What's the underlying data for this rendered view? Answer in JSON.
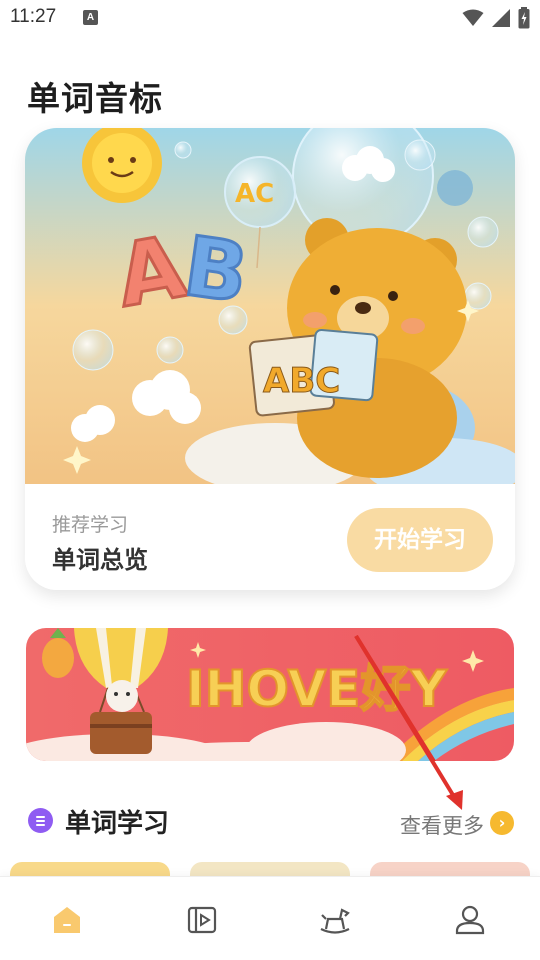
{
  "status_bar": {
    "time": "11:27",
    "notification_icon": "a-icon"
  },
  "page": {
    "title": "单词音标"
  },
  "hero": {
    "subtitle": "推荐学习",
    "title": "单词总览",
    "button_label": "开始学习",
    "button_color": "#f9dba3",
    "art_letters": [
      "A",
      "B",
      "AC",
      "ABC"
    ]
  },
  "banner": {
    "text": "IHOVE好Y"
  },
  "section": {
    "title": "单词学习",
    "more_label": "查看更多",
    "more_arrow": "›",
    "icon_color": "#8f5cf2",
    "arrow_color": "#f6b92f"
  },
  "bottom_nav": {
    "items": [
      {
        "icon": "home-icon",
        "active": true
      },
      {
        "icon": "video-icon",
        "active": false
      },
      {
        "icon": "rocking-horse-icon",
        "active": false
      },
      {
        "icon": "profile-icon",
        "active": false
      }
    ],
    "active_color": "#f9c96e"
  }
}
